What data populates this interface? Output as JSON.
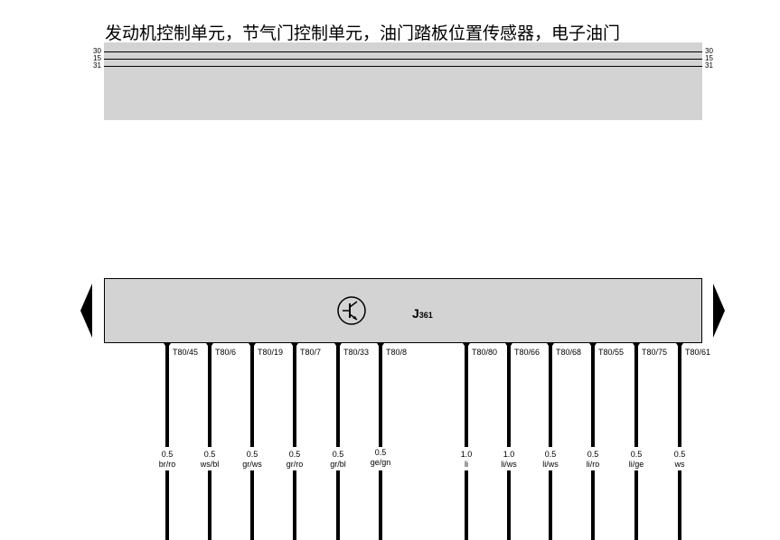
{
  "title": "发动机控制单元，节气门控制单元，油门踏板位置传感器，电子油门",
  "rails": [
    {
      "name": "30"
    },
    {
      "name": "15"
    },
    {
      "name": "31"
    }
  ],
  "module": {
    "label_main": "J",
    "label_sub": "361",
    "icon": "transistor-icon"
  },
  "wires": [
    {
      "pin": "T80/45",
      "size": "0.5",
      "color": "br/ro"
    },
    {
      "pin": "T80/6",
      "size": "0.5",
      "color": "ws/bl"
    },
    {
      "pin": "T80/19",
      "size": "0.5",
      "color": "gr/ws"
    },
    {
      "pin": "T80/7",
      "size": "0.5",
      "color": "gr/ro"
    },
    {
      "pin": "T80/33",
      "size": "0.5",
      "color": "gr/bl"
    },
    {
      "pin": "T80/8",
      "size": "0.5",
      "color": "ge/gn"
    },
    {
      "pin": "T80/80",
      "size": "1.0",
      "color": "li"
    },
    {
      "pin": "T80/66",
      "size": "1.0",
      "color": "li/ws"
    },
    {
      "pin": "T80/68",
      "size": "0.5",
      "color": "li/ws"
    },
    {
      "pin": "T80/55",
      "size": "0.5",
      "color": "li/ro"
    },
    {
      "pin": "T80/75",
      "size": "0.5",
      "color": "li/ge"
    },
    {
      "pin": "T80/61",
      "size": "0.5",
      "color": "ws"
    }
  ]
}
